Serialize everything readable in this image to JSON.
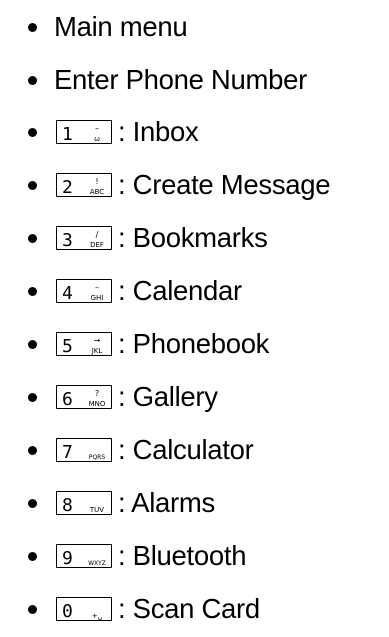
{
  "menu": {
    "items": [
      {
        "label": "Main menu"
      },
      {
        "label": "Enter Phone Number"
      },
      {
        "digit": "1",
        "letters": "ω",
        "symbol": "–",
        "label": ": Inbox",
        "key_icon": "voicemail-key-icon"
      },
      {
        "digit": "2",
        "letters": "ABC",
        "symbol": "!",
        "label": ": Create Message",
        "key_icon": "abc-key-icon"
      },
      {
        "digit": "3",
        "letters": "DEF",
        "symbol": "∕",
        "label": ": Bookmarks",
        "key_icon": "def-key-icon"
      },
      {
        "digit": "4",
        "letters": "GHI",
        "symbol": "–",
        "label": ": Calendar",
        "key_icon": "ghi-key-icon"
      },
      {
        "digit": "5",
        "letters": "JKL",
        "symbol": "→",
        "label": ": Phonebook",
        "key_icon": "jkl-key-icon"
      },
      {
        "digit": "6",
        "letters": "MNO",
        "symbol": "?",
        "label": ": Gallery",
        "key_icon": "mno-key-icon"
      },
      {
        "digit": "7",
        "letters": "PQRS",
        "symbol": "",
        "label": ": Calculator",
        "key_icon": "pqrs-key-icon"
      },
      {
        "digit": "8",
        "letters": "TUV",
        "symbol": "",
        "label": ": Alarms",
        "key_icon": "tuv-key-icon"
      },
      {
        "digit": "9",
        "letters": "WXYZ",
        "symbol": "",
        "label": ": Bluetooth",
        "key_icon": "wxyz-key-icon"
      },
      {
        "digit": "0",
        "letters": "+␣",
        "symbol": "",
        "label": ": Scan Card",
        "key_icon": "zero-key-icon"
      }
    ]
  }
}
